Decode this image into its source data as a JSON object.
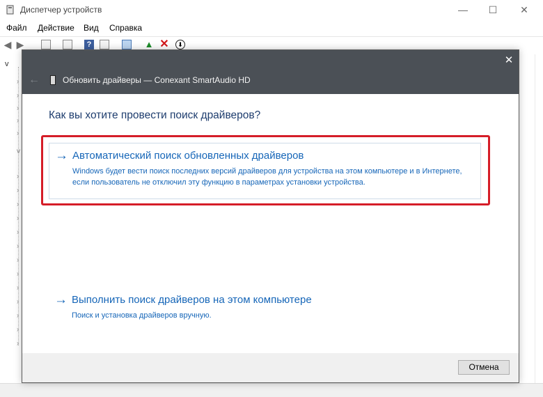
{
  "window": {
    "title": "Диспетчер устройств",
    "controls": {
      "minimize": "—",
      "maximize": "☐",
      "close": "✕"
    }
  },
  "menu": [
    "Файл",
    "Действие",
    "Вид",
    "Справка"
  ],
  "toolbar": {
    "icons": [
      "back-icon",
      "forward-icon",
      "properties-icon",
      "driver-icon",
      "help-icon",
      "view-icon",
      "monitor-icon",
      "update-driver-icon",
      "uninstall-icon",
      "download-icon"
    ],
    "help_glyph": "?",
    "uninstall_glyph": "✕",
    "download_glyph": "⬇"
  },
  "tree": {
    "expander": "v"
  },
  "dialog": {
    "title": "Обновить драйверы — Conexant SmartAudio HD",
    "close": "✕",
    "back": "←",
    "question": "Как вы хотите провести поиск драйверов?",
    "options": [
      {
        "arrow": "→",
        "title": "Автоматический поиск обновленных драйверов",
        "description": "Windows будет вести поиск последних версий драйверов для устройства на этом компьютере и в Интернете, если пользователь не отключил эту функцию в параметрах установки устройства.",
        "highlighted": true
      },
      {
        "arrow": "→",
        "title": "Выполнить поиск драйверов на этом компьютере",
        "description": "Поиск и установка драйверов вручную.",
        "highlighted": false
      }
    ],
    "cancel_label": "Отмена"
  },
  "colors": {
    "header": "#4b5056",
    "link": "#1666b8",
    "question": "#1e3d6e",
    "highlight": "#d51d28"
  }
}
